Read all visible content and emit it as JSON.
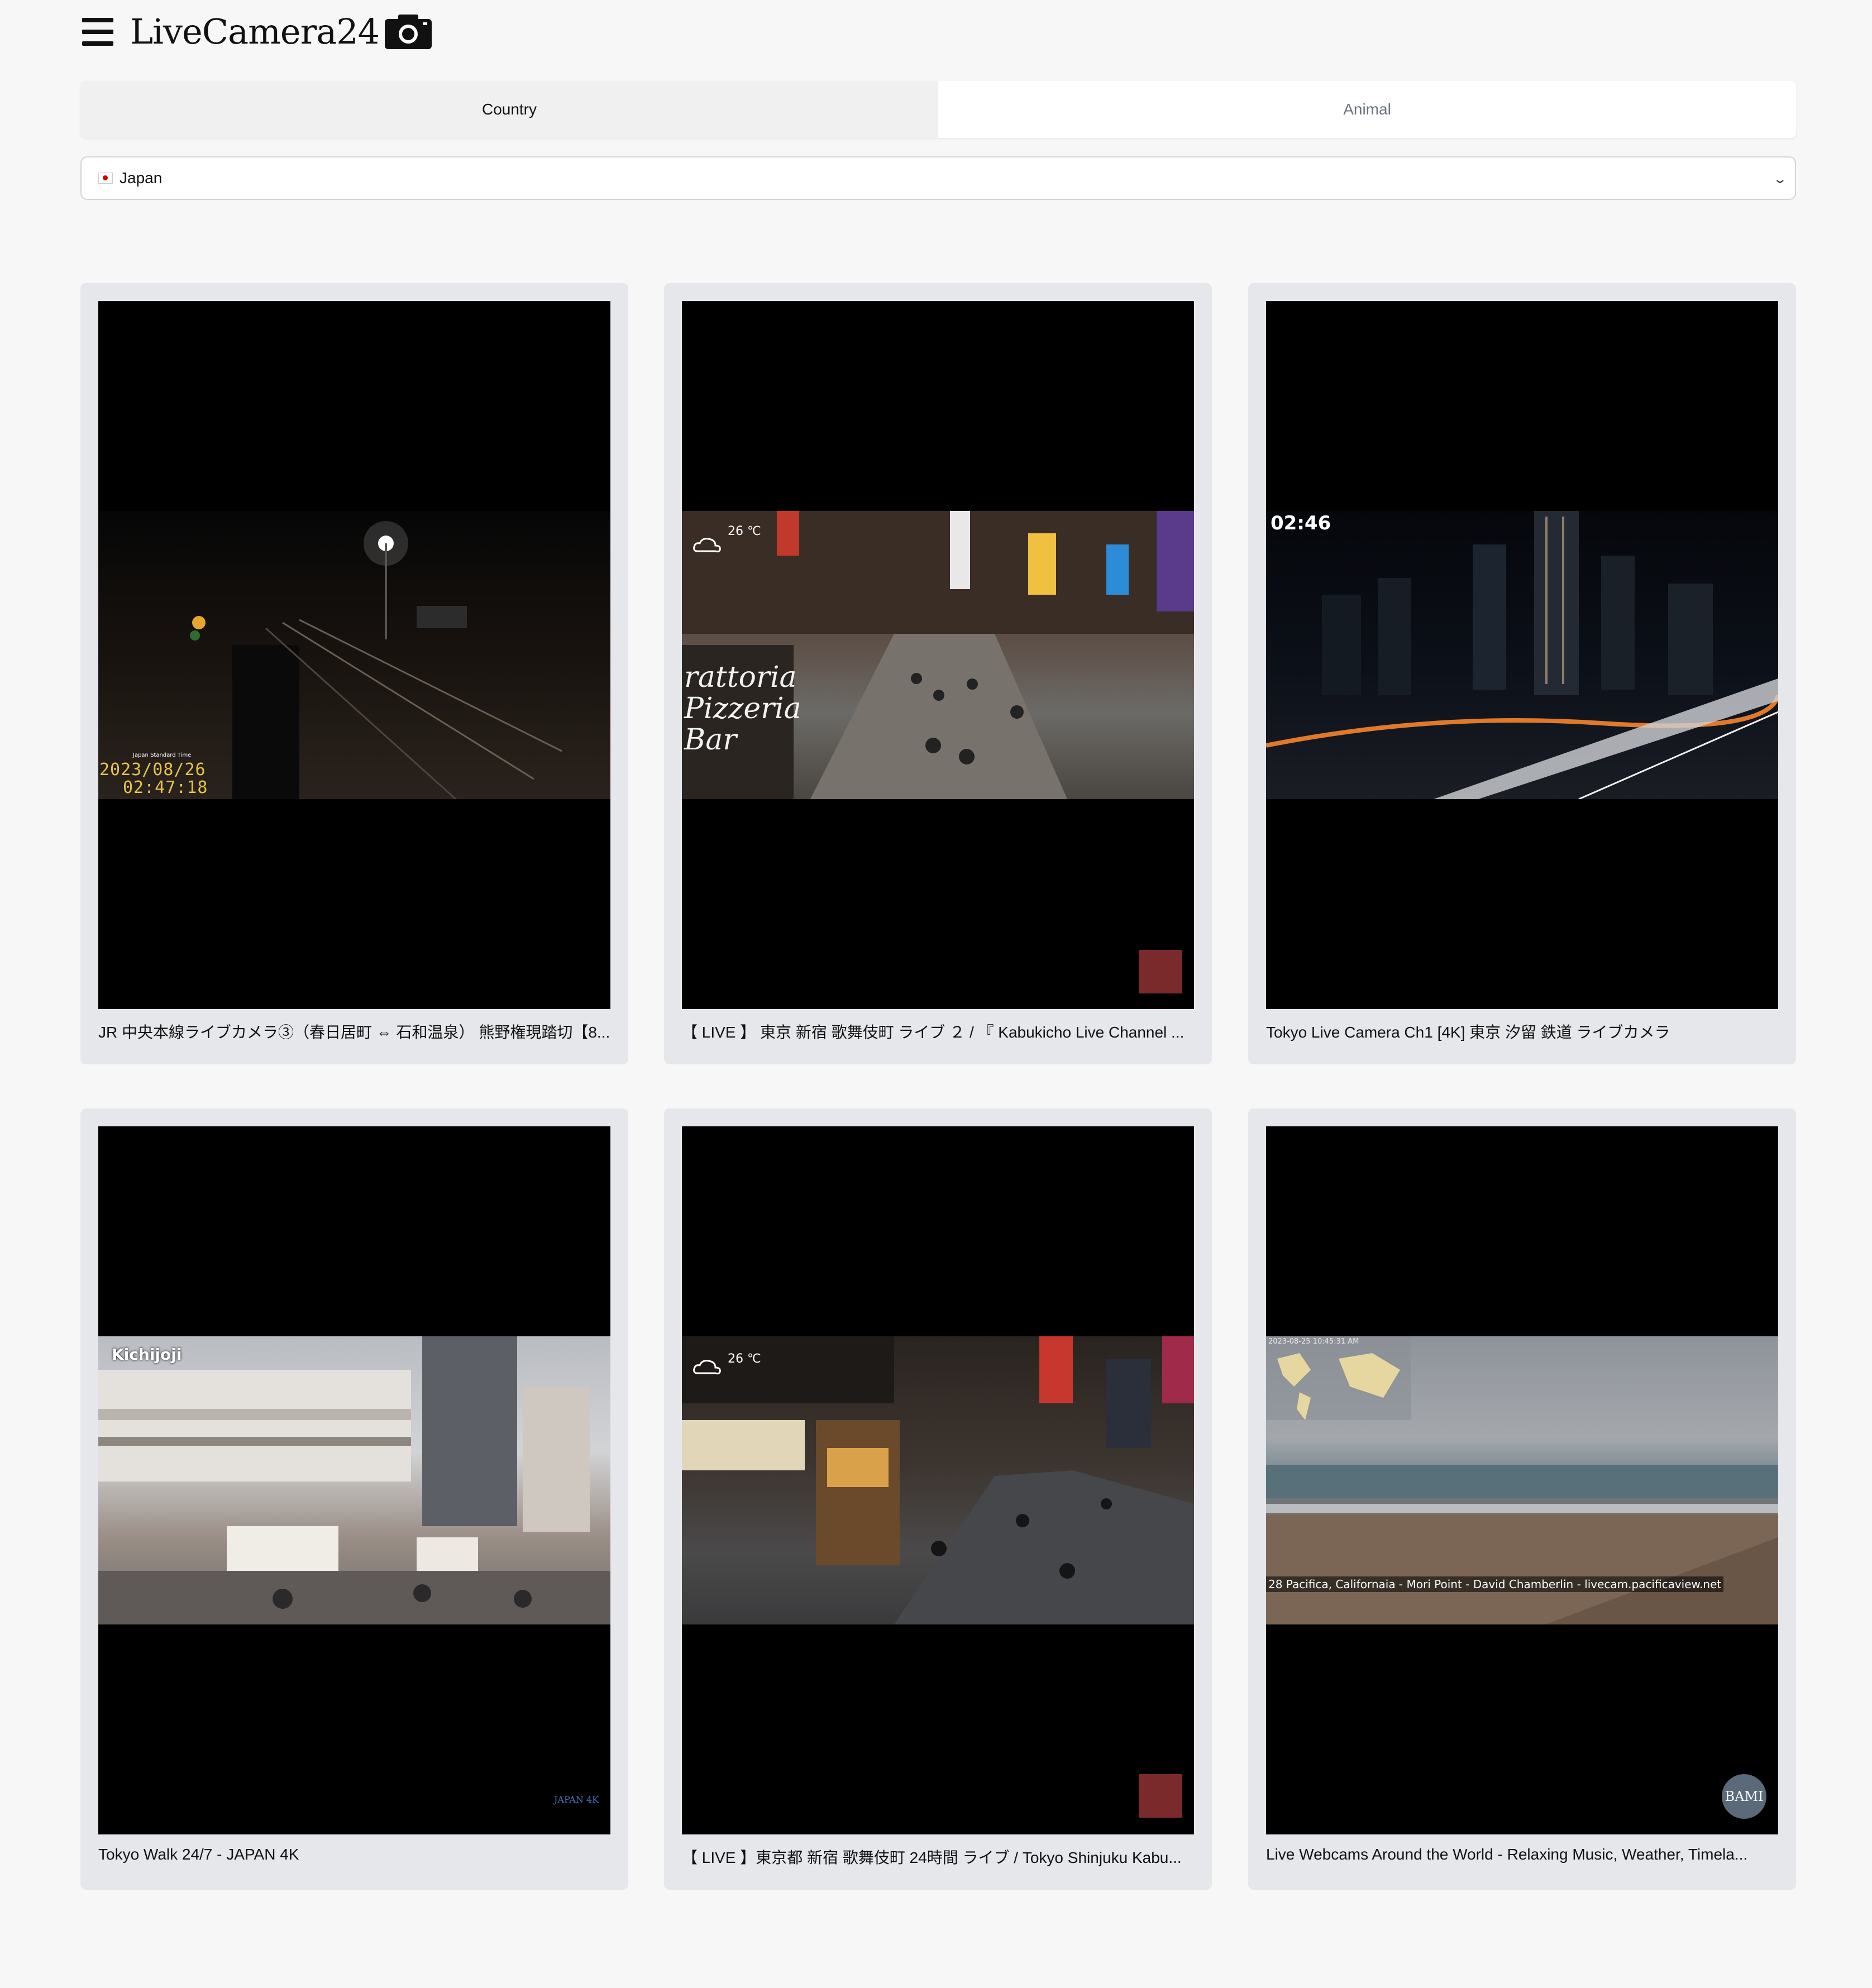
{
  "header": {
    "brand": "LiveCamera24"
  },
  "tabs": [
    {
      "label": "Country",
      "active": true
    },
    {
      "label": "Animal",
      "active": false
    }
  ],
  "country_select": {
    "selected": "Japan"
  },
  "cards": [
    {
      "caption": "JR 中央本線ライブカメラ③（春日居町 ⇔ 石和温泉） 熊野権現踏切【8...",
      "overlay": {
        "label": "Japan Standard Time",
        "date": "2023/08/26",
        "time": "02:47:18"
      }
    },
    {
      "caption": "【 LIVE 】 東京 新宿 歌舞伎町 ライブ ２ / 『 Kabukicho Live Channel ...",
      "overlay": {
        "temp": "26 ℃",
        "sign": "rattoria Pizzeria Bar"
      }
    },
    {
      "caption": "Tokyo Live Camera Ch1 [4K] 東京 汐留 鉄道 ライブカメラ",
      "overlay": {
        "time": "02:46"
      }
    },
    {
      "caption": "Tokyo Walk 24/7 - JAPAN 4K",
      "overlay": {
        "place": "Kichijoji",
        "mark": "JAPAN 4K"
      }
    },
    {
      "caption": "【 LIVE 】東京都 新宿 歌舞伎町 24時間 ライブ / Tokyo Shinjuku Kabu...",
      "overlay": {
        "temp": "26 ℃"
      }
    },
    {
      "caption": "Live Webcams Around the World - Relaxing Music, Weather, Timela...",
      "overlay": {
        "ticker": "28  Pacifica, Californaia - Mori Point - David Chamberlin -  livecam.pacificaview.net",
        "stamp": "2023-08-25 10:45:31 AM",
        "badge": "BAMI"
      }
    }
  ],
  "colors": {
    "page_bg": "#f7f7f8",
    "card_bg": "#e5e7eb",
    "video_bg": "#000000"
  }
}
